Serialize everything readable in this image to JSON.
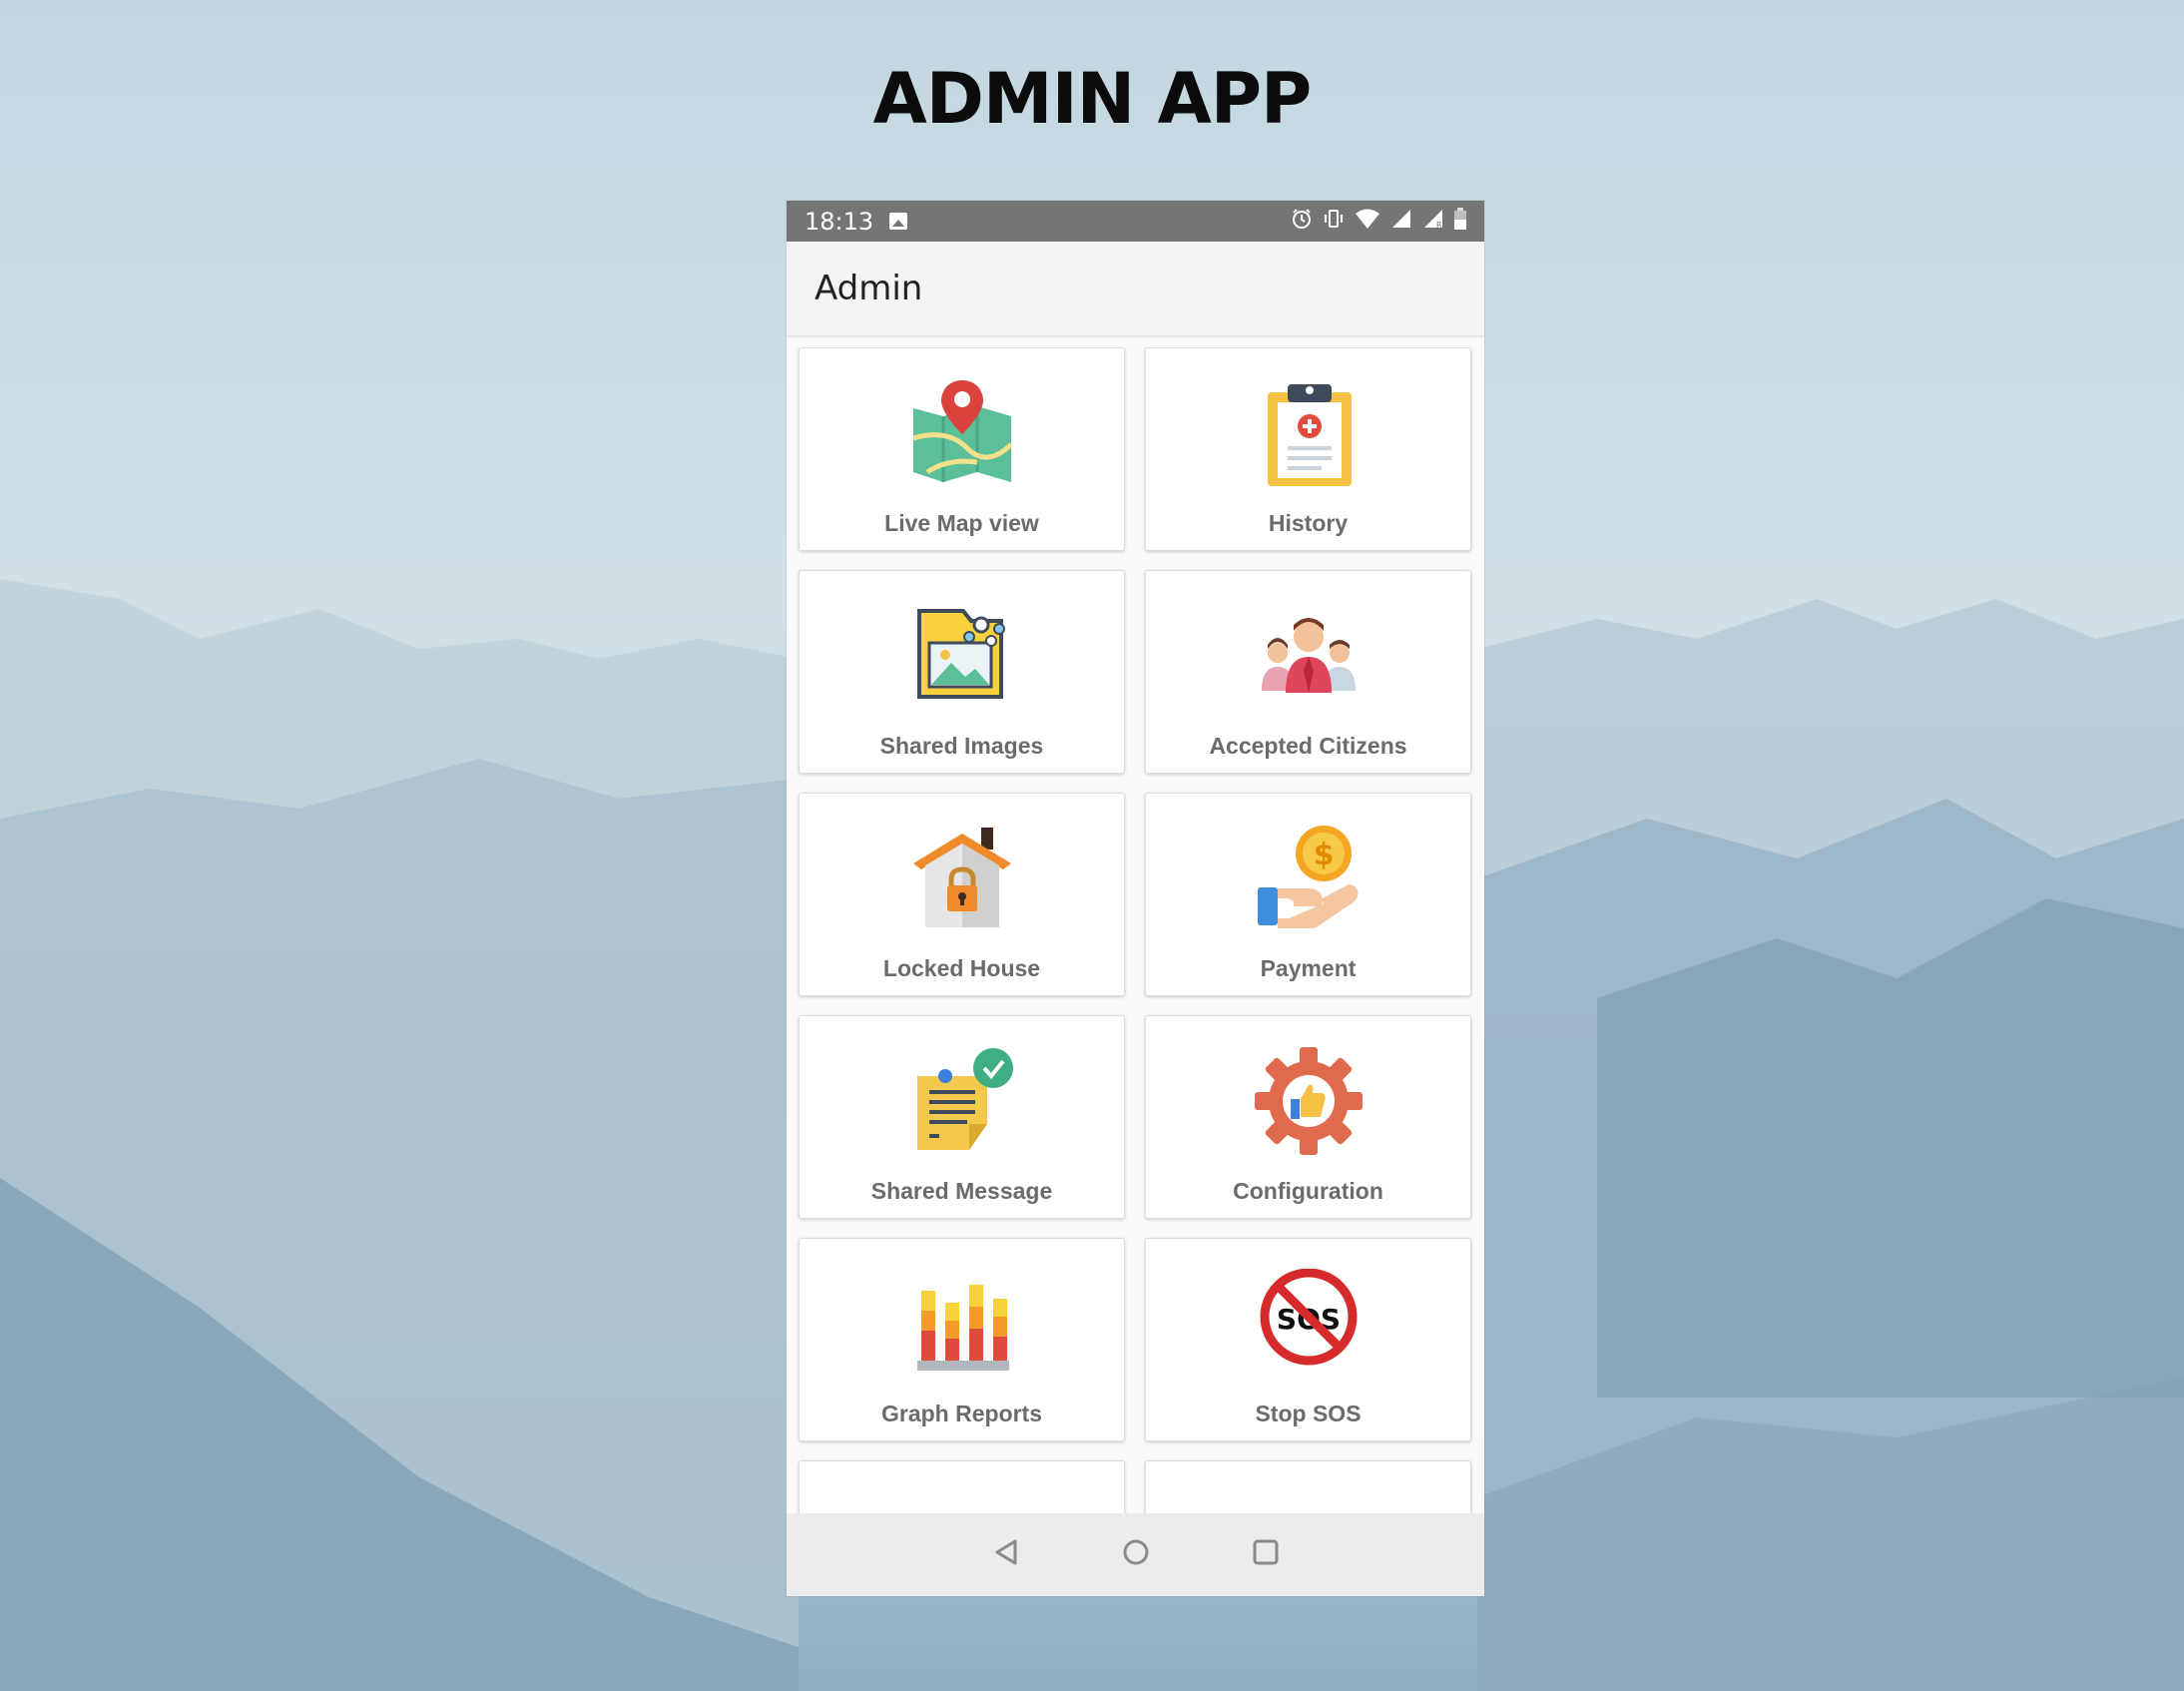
{
  "page": {
    "title": "ADMIN APP"
  },
  "status_bar": {
    "time": "18:13",
    "icons": [
      "image-icon",
      "alarm-icon",
      "vibrate-icon",
      "wifi-icon",
      "signal-icon",
      "signal-r-icon",
      "battery-icon"
    ]
  },
  "app_bar": {
    "title": "Admin"
  },
  "tiles": [
    {
      "label": "Live Map view",
      "icon": "map-pin-icon"
    },
    {
      "label": "History",
      "icon": "clipboard-icon"
    },
    {
      "label": "Shared Images",
      "icon": "image-folder-icon"
    },
    {
      "label": "Accepted Citizens",
      "icon": "people-icon"
    },
    {
      "label": "Locked House",
      "icon": "locked-house-icon"
    },
    {
      "label": "Payment",
      "icon": "payment-hand-icon"
    },
    {
      "label": "Shared Message",
      "icon": "note-check-icon"
    },
    {
      "label": "Configuration",
      "icon": "gear-thumb-icon"
    },
    {
      "label": "Graph Reports",
      "icon": "bar-graph-icon"
    },
    {
      "label": "Stop SOS",
      "icon": "stop-sos-icon"
    },
    {
      "label": "",
      "icon": "clock-icon"
    },
    {
      "label": "",
      "icon": "folder-icon"
    }
  ],
  "nav_bar": {
    "icons": [
      "back-icon",
      "home-icon",
      "recents-icon"
    ]
  },
  "colors": {
    "status_bar": "#757575",
    "app_bar": "#f4f4f4",
    "label": "#6b6b6b"
  }
}
